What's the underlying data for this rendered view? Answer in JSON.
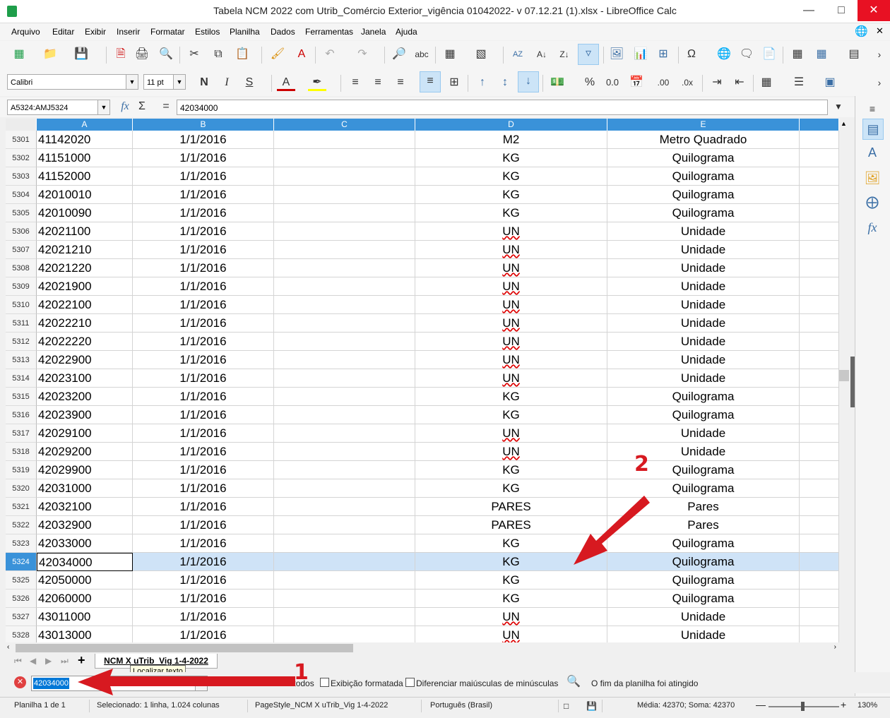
{
  "window": {
    "title": "Tabela NCM 2022 com Utrib_Comércio Exterior_vigência  01042022- v 07.12.21 (1).xlsx - LibreOffice Calc"
  },
  "menu": [
    "Arquivo",
    "Editar",
    "Exibir",
    "Inserir",
    "Formatar",
    "Estilos",
    "Planilha",
    "Dados",
    "Ferramentas",
    "Janela",
    "Ajuda"
  ],
  "format_toolbar": {
    "font_name": "Calibri",
    "font_size": "11 pt"
  },
  "formula_bar": {
    "name_box": "A5324:AMJ5324",
    "content": "42034000"
  },
  "columns": [
    "A",
    "B",
    "C",
    "D",
    "E"
  ],
  "rows": [
    {
      "n": "5301",
      "a": "41142020",
      "b": "1/1/2016",
      "c": "",
      "d": "M2",
      "e": "Metro Quadrado"
    },
    {
      "n": "5302",
      "a": "41151000",
      "b": "1/1/2016",
      "c": "",
      "d": "KG",
      "e": "Quilograma"
    },
    {
      "n": "5303",
      "a": "41152000",
      "b": "1/1/2016",
      "c": "",
      "d": "KG",
      "e": "Quilograma"
    },
    {
      "n": "5304",
      "a": "42010010",
      "b": "1/1/2016",
      "c": "",
      "d": "KG",
      "e": "Quilograma"
    },
    {
      "n": "5305",
      "a": "42010090",
      "b": "1/1/2016",
      "c": "",
      "d": "KG",
      "e": "Quilograma"
    },
    {
      "n": "5306",
      "a": "42021100",
      "b": "1/1/2016",
      "c": "",
      "d": "UN",
      "e": "Unidade"
    },
    {
      "n": "5307",
      "a": "42021210",
      "b": "1/1/2016",
      "c": "",
      "d": "UN",
      "e": "Unidade"
    },
    {
      "n": "5308",
      "a": "42021220",
      "b": "1/1/2016",
      "c": "",
      "d": "UN",
      "e": "Unidade"
    },
    {
      "n": "5309",
      "a": "42021900",
      "b": "1/1/2016",
      "c": "",
      "d": "UN",
      "e": "Unidade"
    },
    {
      "n": "5310",
      "a": "42022100",
      "b": "1/1/2016",
      "c": "",
      "d": "UN",
      "e": "Unidade"
    },
    {
      "n": "5311",
      "a": "42022210",
      "b": "1/1/2016",
      "c": "",
      "d": "UN",
      "e": "Unidade"
    },
    {
      "n": "5312",
      "a": "42022220",
      "b": "1/1/2016",
      "c": "",
      "d": "UN",
      "e": "Unidade"
    },
    {
      "n": "5313",
      "a": "42022900",
      "b": "1/1/2016",
      "c": "",
      "d": "UN",
      "e": "Unidade"
    },
    {
      "n": "5314",
      "a": "42023100",
      "b": "1/1/2016",
      "c": "",
      "d": "UN",
      "e": "Unidade"
    },
    {
      "n": "5315",
      "a": "42023200",
      "b": "1/1/2016",
      "c": "",
      "d": "KG",
      "e": "Quilograma"
    },
    {
      "n": "5316",
      "a": "42023900",
      "b": "1/1/2016",
      "c": "",
      "d": "KG",
      "e": "Quilograma"
    },
    {
      "n": "5317",
      "a": "42029100",
      "b": "1/1/2016",
      "c": "",
      "d": "UN",
      "e": "Unidade"
    },
    {
      "n": "5318",
      "a": "42029200",
      "b": "1/1/2016",
      "c": "",
      "d": "UN",
      "e": "Unidade"
    },
    {
      "n": "5319",
      "a": "42029900",
      "b": "1/1/2016",
      "c": "",
      "d": "KG",
      "e": "Quilograma"
    },
    {
      "n": "5320",
      "a": "42031000",
      "b": "1/1/2016",
      "c": "",
      "d": "KG",
      "e": "Quilograma"
    },
    {
      "n": "5321",
      "a": "42032100",
      "b": "1/1/2016",
      "c": "",
      "d": "PARES",
      "e": "Pares"
    },
    {
      "n": "5322",
      "a": "42032900",
      "b": "1/1/2016",
      "c": "",
      "d": "PARES",
      "e": "Pares"
    },
    {
      "n": "5323",
      "a": "42033000",
      "b": "1/1/2016",
      "c": "",
      "d": "KG",
      "e": "Quilograma"
    },
    {
      "n": "5324",
      "a": "42034000",
      "b": "1/1/2016",
      "c": "",
      "d": "KG",
      "e": "Quilograma"
    },
    {
      "n": "5325",
      "a": "42050000",
      "b": "1/1/2016",
      "c": "",
      "d": "KG",
      "e": "Quilograma"
    },
    {
      "n": "5326",
      "a": "42060000",
      "b": "1/1/2016",
      "c": "",
      "d": "KG",
      "e": "Quilograma"
    },
    {
      "n": "5327",
      "a": "43011000",
      "b": "1/1/2016",
      "c": "",
      "d": "UN",
      "e": "Unidade"
    },
    {
      "n": "5328",
      "a": "43013000",
      "b": "1/1/2016",
      "c": "",
      "d": "UN",
      "e": "Unidade"
    }
  ],
  "selected_row": "5324",
  "sheet_tab": "NCM X uTrib_Vig 1-4-2022",
  "tooltip": "Localizar texto",
  "find_bar": {
    "search_value": "42034000",
    "find_all": "Localizar todos",
    "formatted_display": "Exibição formatada",
    "match_case": "Diferenciar maiúsculas de minúsculas",
    "message": "O fim da planilha foi atingido"
  },
  "status_bar": {
    "sheet": "Planilha 1 de 1",
    "selection": "Selecionado: 1 linha, 1.024 colunas",
    "page_style": "PageStyle_NCM X uTrib_Vig 1-4-2022",
    "language": "Português (Brasil)",
    "stats": "Média: 42370; Soma: 42370",
    "zoom": "130%"
  },
  "annotations": [
    "1",
    "2"
  ],
  "colors": {
    "header_blue": "#3a92d9",
    "selection": "#cfe3f7",
    "annotation_red": "#d71920"
  }
}
